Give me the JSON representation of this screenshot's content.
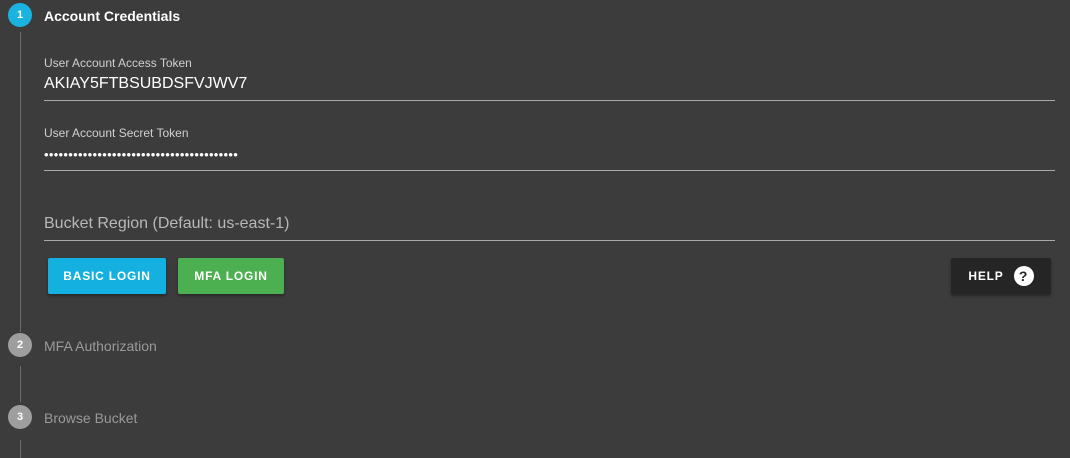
{
  "colors": {
    "background": "#3c3c3c",
    "active_step": "#1ab3e0",
    "inactive_step": "#9e9e9e",
    "basic_login": "#14b1e0",
    "mfa_login": "#4caf50",
    "help_button": "#252525"
  },
  "steps": [
    {
      "number": "1",
      "title": "Account Credentials",
      "state": "active"
    },
    {
      "number": "2",
      "title": "MFA Authorization",
      "state": "inactive"
    },
    {
      "number": "3",
      "title": "Browse Bucket",
      "state": "inactive"
    }
  ],
  "credentials": {
    "access_token": {
      "label": "User Account Access Token",
      "value": "AKIAY5FTBSUBDSFVJWV7"
    },
    "secret_token": {
      "label": "User Account Secret Token",
      "value": "••••••••••••••••••••••••••••••••••••••••"
    },
    "bucket_region": {
      "placeholder": "Bucket Region (Default: us-east-1)",
      "value": ""
    }
  },
  "actions": {
    "basic_login_label": "BASIC LOGIN",
    "mfa_login_label": "MFA LOGIN",
    "help_label": "HELP",
    "help_icon": "help-circle-icon"
  }
}
